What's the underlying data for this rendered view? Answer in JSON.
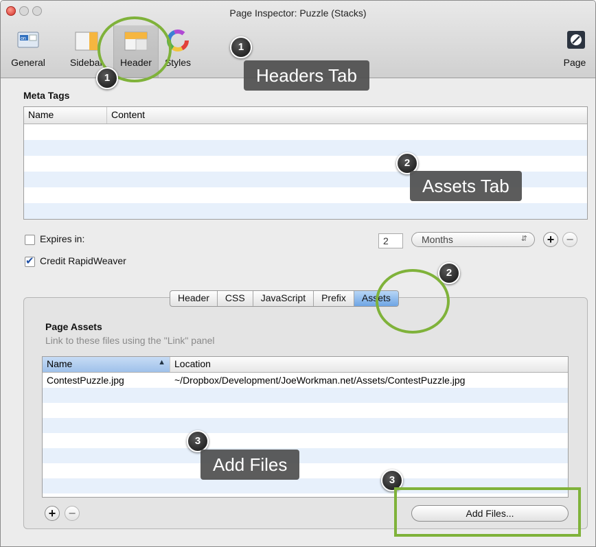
{
  "window": {
    "title": "Page Inspector: Puzzle (Stacks)"
  },
  "toolbar": {
    "items": [
      {
        "label": "General",
        "icon": "general-icon"
      },
      {
        "label": "Sidebar",
        "icon": "sidebar-icon"
      },
      {
        "label": "Header",
        "icon": "header-icon",
        "selected": true
      },
      {
        "label": "Styles",
        "icon": "styles-icon"
      },
      {
        "label": "Page",
        "icon": "page-icon"
      }
    ],
    "general_badge": "on"
  },
  "meta_tags": {
    "title": "Meta Tags",
    "columns": [
      "Name",
      "Content"
    ],
    "rows": []
  },
  "expires": {
    "label": "Expires in:",
    "checked": false,
    "value": "2",
    "unit": "Months"
  },
  "credit": {
    "label": "Credit RapidWeaver",
    "checked": true
  },
  "tabs": {
    "items": [
      "Header",
      "CSS",
      "JavaScript",
      "Prefix",
      "Assets"
    ],
    "active": "Assets"
  },
  "page_assets": {
    "title": "Page Assets",
    "subtitle": "Link to these files using the \"Link\" panel",
    "columns": [
      "Name",
      "Location"
    ],
    "rows": [
      {
        "name": "ContestPuzzle.jpg",
        "location": "~/Dropbox/Development/JoeWorkman.net/Assets/ContestPuzzle.jpg"
      }
    ],
    "add_files_label": "Add Files..."
  },
  "annotations": {
    "badge_1": "1",
    "badge_2": "2",
    "badge_3": "3",
    "callout_1": "Headers Tab",
    "callout_2": "Assets Tab",
    "callout_3": "Add Files",
    "highlight_color": "#7fb23a"
  },
  "colors": {
    "accent_blue": "#6ea5e4",
    "stripe": "#e7f0fb"
  }
}
